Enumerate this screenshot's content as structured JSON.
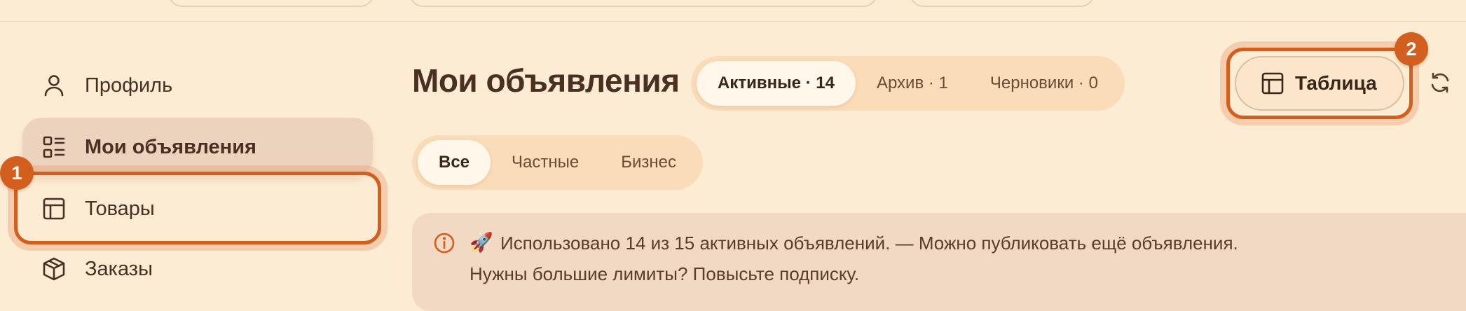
{
  "sidebar": {
    "items": [
      {
        "label": "Профиль",
        "icon": "user-icon"
      },
      {
        "label": "Мои объявления",
        "icon": "list-grid-icon",
        "active": true
      },
      {
        "label": "Товары",
        "icon": "table-icon"
      },
      {
        "label": "Заказы",
        "icon": "box-icon"
      }
    ]
  },
  "main": {
    "title": "Мои объявления",
    "status_tabs": [
      "Активные · 14",
      "Архив · 1",
      "Черновики · 0"
    ],
    "status_active": "Активные · 14",
    "filter_tabs": [
      "Все",
      "Частные",
      "Бизнес"
    ],
    "filter_active": "Все",
    "view_button": {
      "label": "Таблица",
      "icon": "table-icon"
    },
    "refresh_icon": "refresh-icon",
    "notice": {
      "icon": "info-icon",
      "emoji": "🚀",
      "line1": "Использовано 14 из 15 активных объявлений. — Можно публиковать ещё объявления.",
      "line2": "Нужны большие лимиты? Повысьте подписку."
    }
  },
  "annotations": {
    "badge1": "1",
    "badge2": "2"
  },
  "colors": {
    "background": "#fdecd4",
    "accent": "#d25f1d",
    "text": "#4a2f22",
    "segment_bg": "#fbdcb9",
    "notice_bg": "#f2d9c3"
  }
}
